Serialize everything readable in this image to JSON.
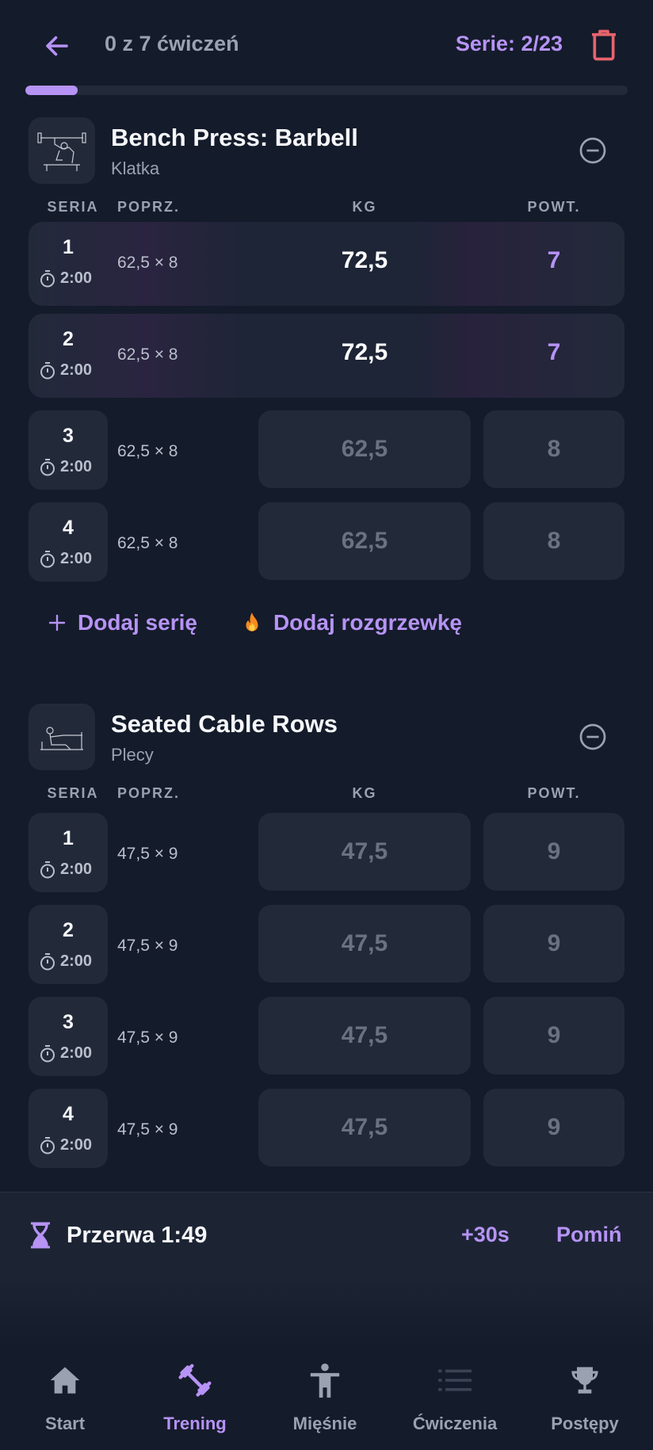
{
  "header": {
    "title": "0 z 7 ćwiczeń",
    "series_count": "Serie: 2/23",
    "progress": 0.087
  },
  "columns": {
    "set": "SERIA",
    "prev": "POPRZ.",
    "kg": "KG",
    "reps": "POWT."
  },
  "exercises": [
    {
      "name": "Bench Press: Barbell",
      "muscle": "Klatka",
      "sets": [
        {
          "num": "1",
          "timer": "2:00",
          "prev": "62,5 × 8",
          "kg": "72,5",
          "reps": "7",
          "done": true
        },
        {
          "num": "2",
          "timer": "2:00",
          "prev": "62,5 × 8",
          "kg": "72,5",
          "reps": "7",
          "done": true
        },
        {
          "num": "3",
          "timer": "2:00",
          "prev": "62,5 × 8",
          "kg": "62,5",
          "reps": "8",
          "done": false
        },
        {
          "num": "4",
          "timer": "2:00",
          "prev": "62,5 × 8",
          "kg": "62,5",
          "reps": "8",
          "done": false
        }
      ]
    },
    {
      "name": "Seated Cable Rows",
      "muscle": "Plecy",
      "sets": [
        {
          "num": "1",
          "timer": "2:00",
          "prev": "47,5 × 9",
          "kg": "47,5",
          "reps": "9",
          "done": false
        },
        {
          "num": "2",
          "timer": "2:00",
          "prev": "47,5 × 9",
          "kg": "47,5",
          "reps": "9",
          "done": false
        },
        {
          "num": "3",
          "timer": "2:00",
          "prev": "47,5 × 9",
          "kg": "47,5",
          "reps": "9",
          "done": false
        },
        {
          "num": "4",
          "timer": "2:00",
          "prev": "47,5 × 9",
          "kg": "47,5",
          "reps": "9",
          "done": false
        }
      ]
    }
  ],
  "actions": {
    "add_set": "Dodaj serię",
    "add_warmup": "Dodaj rozgrzewkę"
  },
  "rest": {
    "label": "Przerwa 1:49",
    "add": "+30s",
    "skip": "Pomiń"
  },
  "nav": [
    {
      "label": "Start",
      "icon": "home-icon",
      "active": false
    },
    {
      "label": "Trening",
      "icon": "dumbbell-icon",
      "active": true
    },
    {
      "label": "Mięśnie",
      "icon": "person-icon",
      "active": false
    },
    {
      "label": "Ćwiczenia",
      "icon": "list-icon",
      "active": false
    },
    {
      "label": "Postępy",
      "icon": "trophy-icon",
      "active": false
    }
  ],
  "colors": {
    "accent": "#b693f5",
    "danger": "#e5646c",
    "background": "#141b2a",
    "card": "#222a3a"
  }
}
